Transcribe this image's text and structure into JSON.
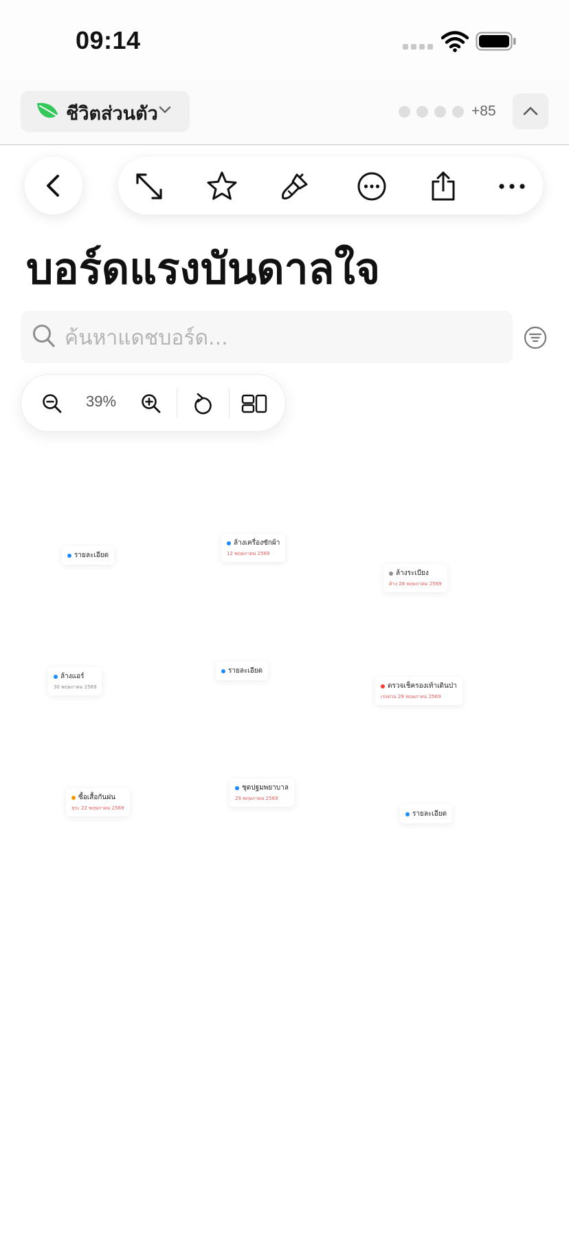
{
  "status_bar": {
    "time": "09:14"
  },
  "workspace": {
    "name": "ชีวิตส่วนตัว",
    "member_count": "+85",
    "accent": "#34c759"
  },
  "board": {
    "title": "บอร์ดแรงบันดาลใจ"
  },
  "search": {
    "placeholder": "ค้นหาแดชบอร์ด..."
  },
  "zoom": {
    "level": "39%"
  },
  "colors": {
    "blue": "#1a8cff",
    "gray": "#8e8e93",
    "red": "#ff3b30",
    "orange": "#ff9500",
    "overdue": "#e55a5a"
  },
  "cards": [
    {
      "title": "รายละเอียด",
      "date": "",
      "dot": "blue"
    },
    {
      "title": "ล้างเครื่องซักผ้า",
      "date": "12 พฤษภาคม 2569",
      "dot": "blue"
    },
    {
      "title": "ล้างระเบียง",
      "date": "ค้าง 28 พฤษภาคม 2569",
      "dot": "gray"
    },
    {
      "title": "ล้างแอร์",
      "date": "30 พฤษภาคม 2569",
      "dot": "blue"
    },
    {
      "title": "รายละเอียด",
      "date": "",
      "dot": "blue"
    },
    {
      "title": "ตรวจเช็ครองเท้าเดินป่า",
      "date": "เร่งด่วน 29 พฤษภาคม 2569",
      "dot": "red"
    },
    {
      "title": "ซื้อเสื้อกันฝน",
      "date": "ธุระ 22 พฤษภาคม 2569",
      "dot": "orange"
    },
    {
      "title": "ชุดปฐมพยาบาล",
      "date": "29 พฤษภาคม 2569",
      "dot": "blue"
    },
    {
      "title": "รายละเอียด",
      "date": "",
      "dot": "blue"
    }
  ]
}
